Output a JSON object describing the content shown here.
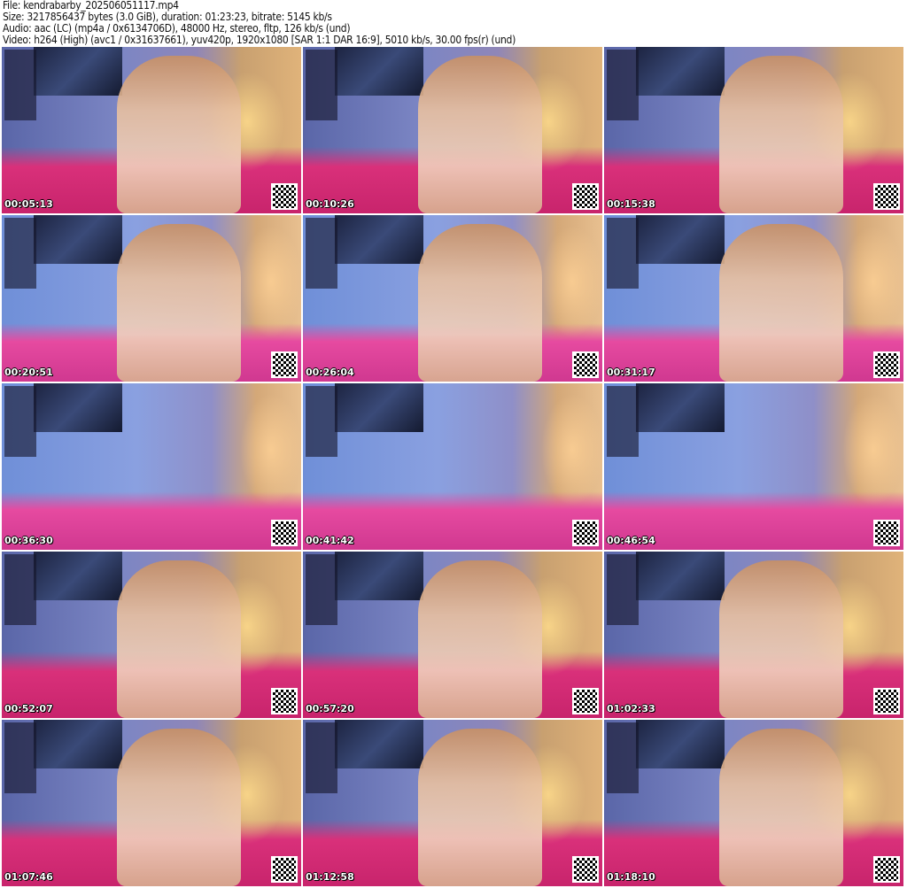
{
  "header": {
    "file": "File: kendrabarby_202506051117.mp4",
    "size": "Size: 3217856437 bytes (3.0 GiB), duration: 01:23:23, bitrate: 5145 kb/s",
    "audio": "Audio: aac (LC) (mp4a / 0x6134706D), 48000 Hz, stereo, fltp, 126 kb/s (und)",
    "video": "Video: h264 (High) (avc1 / 0x31637661), yuv420p, 1920x1080 [SAR 1:1 DAR 16:9], 5010 kb/s, 30.00 fps(r) (und)"
  },
  "thumbnails": [
    {
      "timestamp": "00:05:13"
    },
    {
      "timestamp": "00:10:26"
    },
    {
      "timestamp": "00:15:38"
    },
    {
      "timestamp": "00:20:51"
    },
    {
      "timestamp": "00:26:04"
    },
    {
      "timestamp": "00:31:17"
    },
    {
      "timestamp": "00:36:30"
    },
    {
      "timestamp": "00:41:42"
    },
    {
      "timestamp": "00:46:54"
    },
    {
      "timestamp": "00:52:07"
    },
    {
      "timestamp": "00:57:20"
    },
    {
      "timestamp": "01:02:33"
    },
    {
      "timestamp": "01:07:46"
    },
    {
      "timestamp": "01:12:58"
    },
    {
      "timestamp": "01:18:10"
    }
  ]
}
